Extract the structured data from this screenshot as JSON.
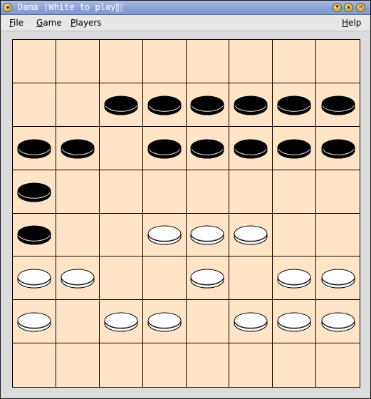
{
  "window": {
    "title": "Dama (White to play)"
  },
  "menubar": {
    "items": [
      {
        "label": "File",
        "mnemonic": "F",
        "rest": "ile"
      },
      {
        "label": "Game",
        "mnemonic": "G",
        "rest": "ame"
      },
      {
        "label": "Players",
        "mnemonic": "P",
        "rest": "layers"
      },
      {
        "label": "Help",
        "mnemonic": "H",
        "rest": "elp"
      }
    ]
  },
  "board": {
    "rows": 8,
    "cols": 8,
    "cell_color": "#ffe5c6",
    "line_color": "#000000",
    "layout": [
      "........",
      "..bbbbbb",
      "bb.bbbbb",
      "b.......",
      "b..www..",
      "ww..w.ww",
      "w.ww.www",
      "........"
    ]
  },
  "colors": {
    "black_piece": "#000000",
    "white_piece": "#ffffff",
    "titlebar": "#8aa3d6"
  }
}
